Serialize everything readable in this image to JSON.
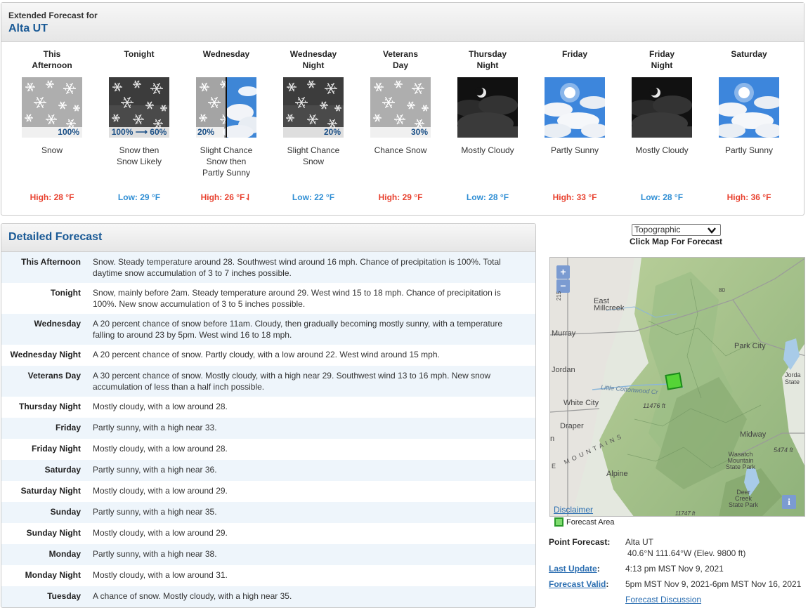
{
  "header": {
    "small_title": "Extended Forecast for",
    "location": "Alta UT"
  },
  "periods": [
    {
      "name": [
        "This",
        "Afternoon"
      ],
      "icon": "snow-icon",
      "pct": "100%",
      "short": [
        "Snow"
      ],
      "temp": "High: 28 °F",
      "kind": "hi"
    },
    {
      "name": [
        "Tonight"
      ],
      "icon": "night-snow-icon",
      "pct": "100% ⟶ 60%",
      "short": [
        "Snow then",
        "Snow Likely"
      ],
      "temp": "Low: 29 °F",
      "kind": "lo"
    },
    {
      "name": [
        "Wednesday"
      ],
      "icon": "snow-then-partly-sunny-icon",
      "pct": "20%",
      "short": [
        "Slight Chance",
        "Snow then",
        "Partly Sunny"
      ],
      "temp": "High: 26 °F⇃",
      "kind": "hi"
    },
    {
      "name": [
        "Wednesday",
        "Night"
      ],
      "icon": "night-snow-icon",
      "pct": "20%",
      "short": [
        "Slight Chance",
        "Snow"
      ],
      "temp": "Low: 22 °F",
      "kind": "lo"
    },
    {
      "name": [
        "Veterans",
        "Day"
      ],
      "icon": "snow-icon",
      "pct": "30%",
      "short": [
        "Chance Snow"
      ],
      "temp": "High: 29 °F",
      "kind": "hi"
    },
    {
      "name": [
        "Thursday",
        "Night"
      ],
      "icon": "mostly-cloudy-night-icon",
      "pct": "",
      "short": [
        "Mostly Cloudy"
      ],
      "temp": "Low: 28 °F",
      "kind": "lo"
    },
    {
      "name": [
        "Friday"
      ],
      "icon": "partly-sunny-icon",
      "pct": "",
      "short": [
        "Partly Sunny"
      ],
      "temp": "High: 33 °F",
      "kind": "hi"
    },
    {
      "name": [
        "Friday",
        "Night"
      ],
      "icon": "mostly-cloudy-night-icon",
      "pct": "",
      "short": [
        "Mostly Cloudy"
      ],
      "temp": "Low: 28 °F",
      "kind": "lo"
    },
    {
      "name": [
        "Saturday"
      ],
      "icon": "partly-sunny-icon",
      "pct": "",
      "short": [
        "Partly Sunny"
      ],
      "temp": "High: 36 °F",
      "kind": "hi"
    }
  ],
  "detailed": {
    "title": "Detailed Forecast",
    "rows": [
      {
        "label": "This Afternoon",
        "text": "Snow. Steady temperature around 28. Southwest wind around 16 mph. Chance of precipitation is 100%. Total daytime snow accumulation of 3 to 7 inches possible."
      },
      {
        "label": "Tonight",
        "text": "Snow, mainly before 2am. Steady temperature around 29. West wind 15 to 18 mph. Chance of precipitation is 100%. New snow accumulation of 3 to 5 inches possible."
      },
      {
        "label": "Wednesday",
        "text": "A 20 percent chance of snow before 11am. Cloudy, then gradually becoming mostly sunny, with a temperature falling to around 23 by 5pm. West wind 16 to 18 mph."
      },
      {
        "label": "Wednesday Night",
        "text": "A 20 percent chance of snow. Partly cloudy, with a low around 22. West wind around 15 mph."
      },
      {
        "label": "Veterans Day",
        "text": "A 30 percent chance of snow. Mostly cloudy, with a high near 29. Southwest wind 13 to 16 mph. New snow accumulation of less than a half inch possible."
      },
      {
        "label": "Thursday Night",
        "text": "Mostly cloudy, with a low around 28."
      },
      {
        "label": "Friday",
        "text": "Partly sunny, with a high near 33."
      },
      {
        "label": "Friday Night",
        "text": "Mostly cloudy, with a low around 28."
      },
      {
        "label": "Saturday",
        "text": "Partly sunny, with a high near 36."
      },
      {
        "label": "Saturday Night",
        "text": "Mostly cloudy, with a low around 29."
      },
      {
        "label": "Sunday",
        "text": "Partly sunny, with a high near 35."
      },
      {
        "label": "Sunday Night",
        "text": "Mostly cloudy, with a low around 29."
      },
      {
        "label": "Monday",
        "text": "Partly sunny, with a high near 38."
      },
      {
        "label": "Monday Night",
        "text": "Mostly cloudy, with a low around 31."
      },
      {
        "label": "Tuesday",
        "text": "A chance of snow. Mostly cloudy, with a high near 35."
      }
    ]
  },
  "map": {
    "select_value": "Topographic",
    "caption": "Click Map For Forecast",
    "zoom_in": "+",
    "zoom_out": "−",
    "disclaimer": "Disclaimer",
    "info": "i",
    "legend": "Forecast Area",
    "labels": {
      "east_millcreek": "East\nMillcreek",
      "murray": "Murray",
      "park_city": "Park City",
      "jordan": "Jordan",
      "jordan_state": "Jorda\nState",
      "little_cottonwood": "Little Cottonwood Cr",
      "elev_11476": "11476 ft",
      "white_city": "White City",
      "draper": "Draper",
      "midway": "Midway",
      "elev_5474": "5474 ft",
      "wasatch": "Wasatch\nMountain\nState Park",
      "alpine": "Alpine",
      "deer_creek": "Deer\nCreek\nState Park",
      "mountains": "M O U N T A I N S",
      "hwy_80": "80",
      "hwy_215": "215",
      "e": "E",
      "n": "n",
      "elev_11747": "11747 ft"
    }
  },
  "point_info": {
    "point_label": "Point Forecast:",
    "point_value": "Alta UT",
    "coords": "40.6°N 111.64°W (Elev. 9800 ft)",
    "update_label": "Last Update",
    "update_colon": ":",
    "update_value": "4:13 pm MST Nov 9, 2021",
    "valid_label": "Forecast Valid",
    "valid_colon": ":",
    "valid_value": "5pm MST Nov 9, 2021-6pm MST Nov 16, 2021",
    "discussion": "Forecast Discussion"
  },
  "colors": {
    "high": "#e8412f",
    "low": "#2f8ed4",
    "header_blue": "#1a5a96",
    "link": "#2b6eb1"
  }
}
